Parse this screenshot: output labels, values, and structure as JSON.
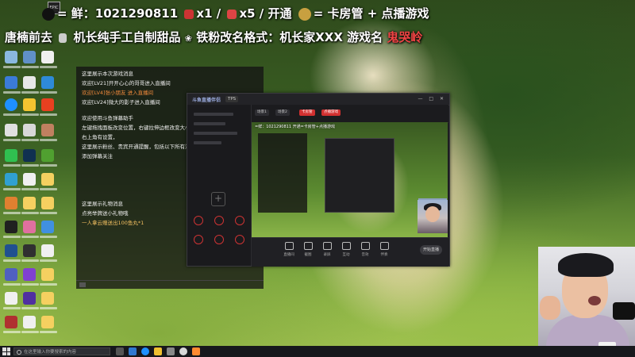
{
  "overlay": {
    "line1": "= 鲜：1021290811",
    "line1_rocket": "x1 /",
    "line1_plane": "x5 / 开通",
    "line1_badge": "= 卡房管 + 点播游戏",
    "epic_label": "EPIC",
    "line2_a": "唐楠前去",
    "line2_b": "机长纯手工自制甜品",
    "line2_c": "铁粉改名格式：机长家XXX",
    "line2_d": "游戏名",
    "line2_e": "鬼哭岭"
  },
  "chat": {
    "lines": [
      {
        "text": "这里展示本次游戏消息",
        "style": ""
      },
      {
        "text": "欢迎[LV21]开开心心的哥哥进入直播间",
        "style": ""
      },
      {
        "text": "欢迎[LV4]张小朋友 进入直播间",
        "style": ""
      },
      {
        "text": "欢迎[LV24]微大的影子进入直播间",
        "style": ""
      },
      {
        "text": "欢迎使用斗鱼弹幕助手",
        "style": ""
      },
      {
        "text": "左键拖拽面板改变位置，右键拉伸边框改变大小",
        "style": ""
      },
      {
        "text": "右上角有设置，",
        "style": ""
      },
      {
        "text": "这里展示粉丝、贵宾开通提醒，包括以下所有消息",
        "style": ""
      },
      {
        "text": "添加弹幕关注",
        "style": ""
      },
      {
        "text": "这里展示礼物消息",
        "style": ""
      },
      {
        "text": "点亮举牌送小礼物哦",
        "style": ""
      },
      {
        "text": "一人拿云赠送出100鱼丸*1",
        "style": "gold"
      }
    ]
  },
  "stream_app": {
    "logo": "斗鱼直播伴侣",
    "tab": "TPS",
    "controls": "— □ ✕",
    "scenes": [
      "场景1",
      "场景2",
      "卡房管",
      "点播游戏"
    ],
    "toolbar": [
      "直播间",
      "截图",
      "录屏",
      "互动",
      "音效",
      "伴奏"
    ],
    "start_label": "开始直播",
    "preview_banner": "=鲜：1021290811 开通=卡房管+点播游戏"
  },
  "taskbar": {
    "search_placeholder": "在这里输入你要搜索的内容"
  },
  "colors": {
    "accent_red": "#d23030",
    "chat_gold": "#f3c060"
  }
}
